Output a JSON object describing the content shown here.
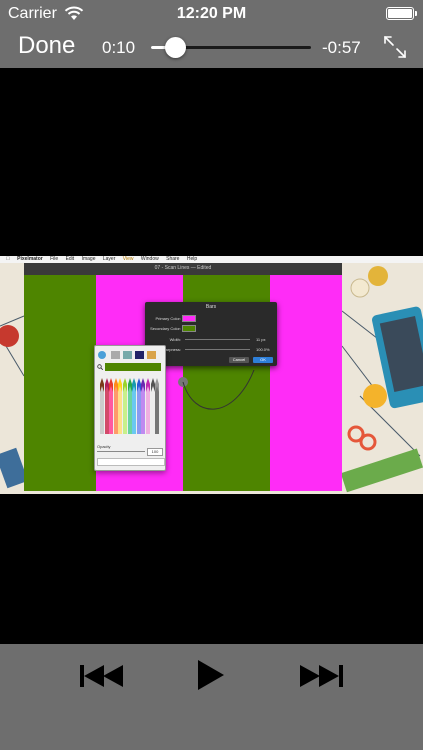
{
  "status_bar": {
    "carrier": "Carrier",
    "time": "12:20 PM",
    "wifi_icon": "wifi-icon",
    "battery_icon": "battery-icon"
  },
  "player": {
    "done_label": "Done",
    "elapsed": "0:10",
    "remaining": "-0:57",
    "progress": 0.15,
    "fullscreen_icon": "fullscreen-expand-icon"
  },
  "video_frame": {
    "menubar": [
      "Pixelmator",
      "File",
      "Edit",
      "Image",
      "Layer",
      "View",
      "Window",
      "Share",
      "Help"
    ],
    "window_title": "07 - Scan Lines — Edited",
    "dialog": {
      "title": "Bars",
      "primary_color_label": "Primary Color:",
      "secondary_color_label": "Secondary Color:",
      "width_label": "Width:",
      "width_value": "11 px",
      "sharpness_label": "Sharpness:",
      "sharpness_value": "100.0%",
      "cancel_label": "Cancel",
      "ok_label": "OK"
    },
    "color_panel": {
      "opacity_label": "Opacity",
      "opacity_value": "100"
    },
    "colors": {
      "green": "#4e8500",
      "magenta": "#ff2cf7",
      "bg": "#ece6d9"
    }
  },
  "transport": {
    "previous_icon": "skip-previous-icon",
    "play_icon": "play-icon",
    "next_icon": "skip-next-icon"
  },
  "colors": {
    "bar": "#6e6e6e",
    "video_bg": "#000000"
  }
}
